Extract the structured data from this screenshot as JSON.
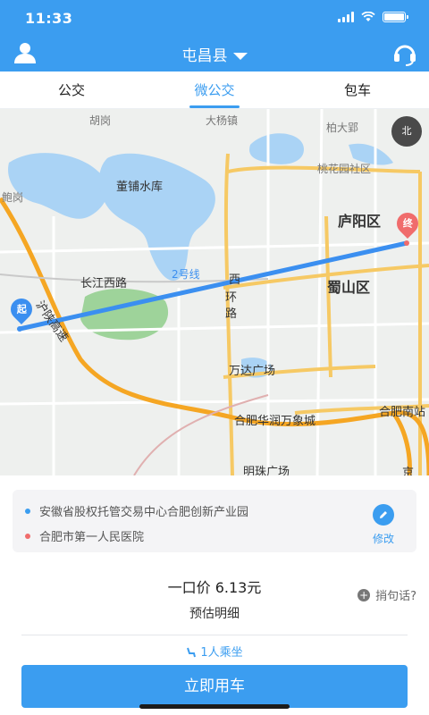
{
  "status_bar": {
    "time": "11:33"
  },
  "nav": {
    "title": "屯昌县"
  },
  "tabs": [
    {
      "label": "公交",
      "active": false
    },
    {
      "label": "微公交",
      "active": true
    },
    {
      "label": "包车",
      "active": false
    }
  ],
  "map": {
    "labels": {
      "hugang": "胡岗",
      "dayanggang": "大杨镇",
      "baidaying": "柏大郢",
      "taohuayuan": "桃花园社区",
      "dongpu": "董铺水库",
      "heping": "鲍岗",
      "luyang": "庐阳区",
      "changjiang": "长江西路",
      "line2": "2号线",
      "xihuan1": "西",
      "xihuan2": "环",
      "xihuan3": "路",
      "shushan": "蜀山区",
      "husan": "沪陕高速",
      "wanda": "万达广场",
      "huarun": "合肥华润万象城",
      "hefei_south": "合肥南站",
      "mingzhu": "明珠广场",
      "jing": "京"
    },
    "start_marker": "起",
    "end_marker": "终",
    "compass": "北"
  },
  "addresses": {
    "start": "安徽省股权托管交易中心合肥创新产业园",
    "end": "合肥市第一人民医院",
    "edit_label": "修改"
  },
  "price": {
    "text": "一口价 6.13元",
    "detail": "预估明细"
  },
  "message": {
    "label": "捎句话?"
  },
  "passengers": {
    "label": "1人乘坐"
  },
  "cta": {
    "label": "立即用车"
  },
  "colors": {
    "primary": "#3b9df0",
    "start_dot": "#3b9df0",
    "end_dot": "#f06c6c"
  }
}
